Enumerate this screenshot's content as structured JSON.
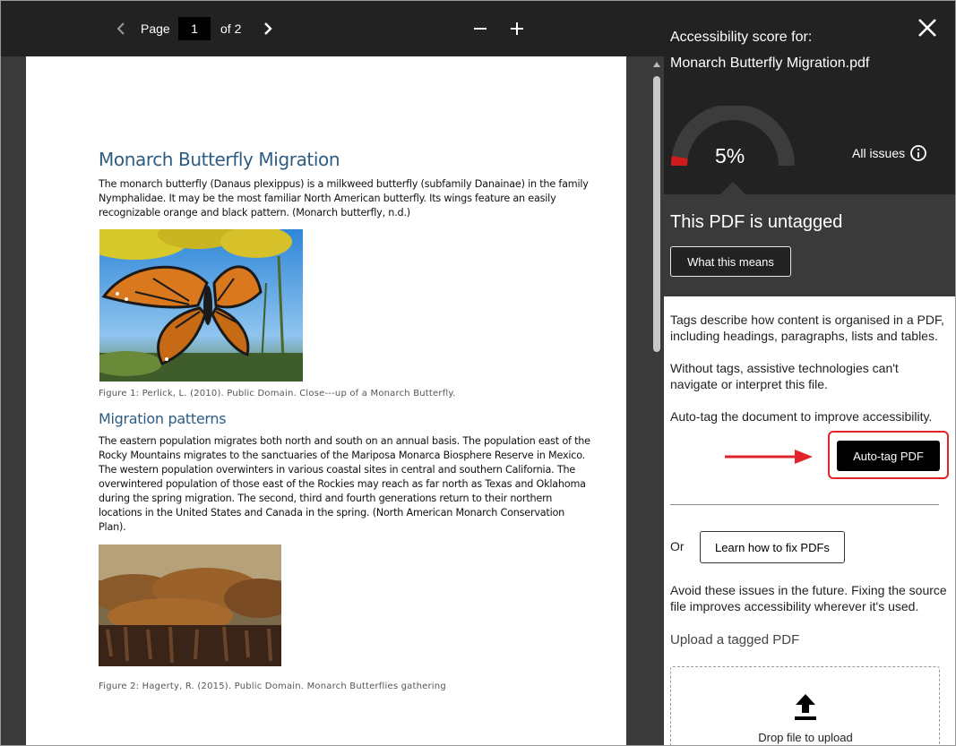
{
  "toolbar": {
    "page_label": "Page",
    "page_value": "1",
    "page_total": "of 2"
  },
  "document": {
    "title": "Monarch Butterfly Migration",
    "intro_lines": [
      "The monarch butterfly (Danaus plexippus) is a milkweed butterfly (subfamily Danainae) in the family",
      "Nymphalidae. It may be the most familiar North American butterfly. Its wings feature an easily",
      "recognizable orange and black pattern. (Monarch  butterfly, n.d.)"
    ],
    "figure1_caption": "Figure 1: Perlick, L. (2010). Public Domain. Close---up of a Monarch Butterfly.",
    "section_heading": "Migration patterns",
    "section_lines": [
      "The eastern population migrates both north and south on an annual basis. The population east of the",
      "Rocky Mountains migrates to the sanctuaries of the Mariposa Monarca Biosphere Reserve in Mexico.",
      "The western population overwinters in various coastal sites in central and southern California. The",
      "overwintered population of those east of the Rockies may reach as far north as Texas and Oklahoma",
      "during the spring migration. The second, third and fourth generations return to their northern",
      "locations in the United States and Canada in the spring.  (North American Monarch Conservation",
      "Plan)."
    ],
    "figure2_caption": "Figure 2: Hagerty, R. (2015). Public Domain. Monarch Butterflies gathering"
  },
  "panel": {
    "score_for_label": "Accessibility score for:",
    "file_name": "Monarch Butterfly Migration.pdf",
    "score_text": "5%",
    "score_value": 5,
    "all_issues_label": "All issues",
    "status_title": "This PDF is untagged",
    "what_this_means_label": "What this means",
    "para1": "Tags describe how content is organised in a PDF, including headings, paragraphs, lists and tables.",
    "para2": "Without tags, assistive technologies can't navigate or interpret this file.",
    "para3": "Auto-tag the document to improve accessibility.",
    "autotag_label": "Auto-tag PDF",
    "or_label": "Or",
    "learn_label": "Learn how to fix PDFs",
    "para4": "Avoid these issues in the future. Fixing the source file improves accessibility wherever it's used.",
    "upload_label": "Upload a tagged PDF",
    "drop_label": "Drop file to upload"
  },
  "colors": {
    "panel_dark": "#222222",
    "panel_mid": "#3a3a3a",
    "doc_heading": "#2d5c82",
    "gauge_score": "#d11a1a",
    "gauge_track": "#3c3c3c",
    "highlight": "#e1232b"
  },
  "icons": {
    "prev": "chevron-left-icon",
    "next": "chevron-right-icon",
    "zoom_out": "minus-icon",
    "zoom_in": "plus-icon",
    "close": "close-icon",
    "info": "info-icon",
    "upload": "upload-icon"
  }
}
